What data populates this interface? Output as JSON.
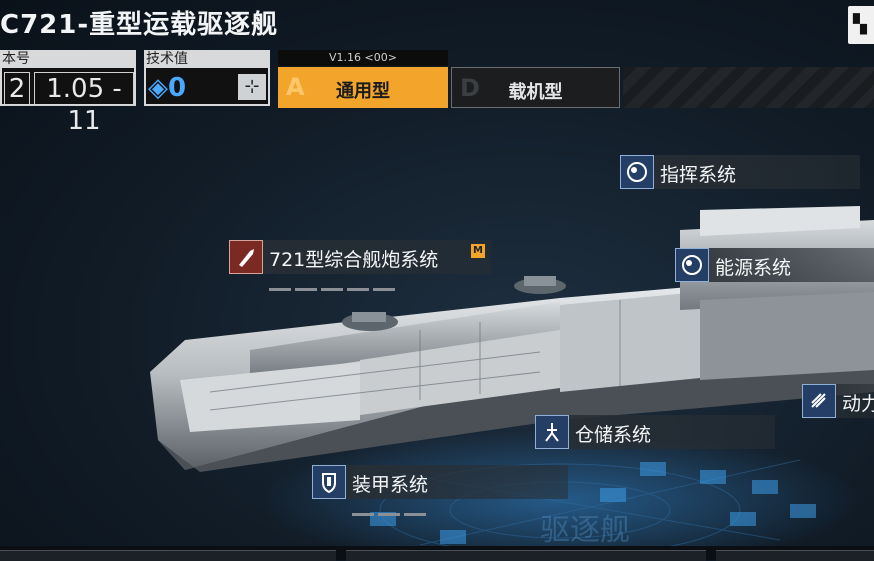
{
  "header": {
    "title": "C721-重型运载驱逐舰"
  },
  "version_panel": {
    "label": "本号",
    "major": "2",
    "minor": "1.05 - 11"
  },
  "tech_panel": {
    "label": "技术值",
    "value": "0",
    "adjust_symbol": "⊹"
  },
  "mode_tabs": {
    "version_tag": "V1.16 <00>",
    "tabs": [
      {
        "letter": "A",
        "label": "通用型",
        "active": true
      },
      {
        "letter": "D",
        "label": "载机型",
        "active": false
      }
    ]
  },
  "systems": [
    {
      "name": "指挥系统",
      "icon": "target-icon"
    },
    {
      "name": "721型综合舰炮系统",
      "icon": "shell-icon",
      "badge": "M"
    },
    {
      "name": "能源系统",
      "icon": "target-icon"
    },
    {
      "name": "动力",
      "icon": "engine-icon"
    },
    {
      "name": "仓储系统",
      "icon": "crane-icon"
    },
    {
      "name": "装甲系统",
      "icon": "shield-icon"
    }
  ],
  "watermark": "驱逐舰",
  "colors": {
    "accent": "#f2a52a",
    "tech_value": "#4aa8ff",
    "icon_bg": "#243e66",
    "weapon_icon_bg": "#7a2a22"
  }
}
